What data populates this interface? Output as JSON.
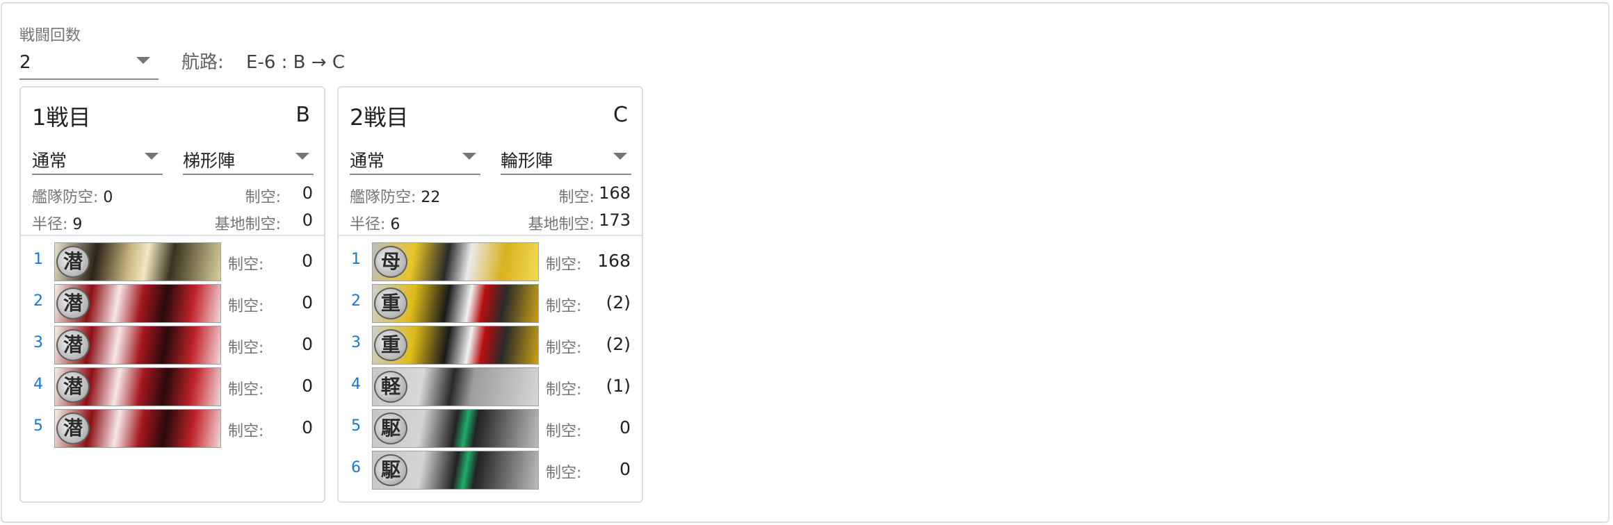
{
  "battle_count": {
    "label": "戦闘回数",
    "value": "2"
  },
  "route": {
    "label": "航路:",
    "value": "E-6 : B → C"
  },
  "cards": [
    {
      "title": "1戦目",
      "node": "B",
      "kind": "通常",
      "formation": "梯形陣",
      "fleet_aa_label": "艦隊防空:",
      "fleet_aa": "0",
      "radius_label": "半径:",
      "radius": "9",
      "air_label": "制空:",
      "air": "0",
      "base_air_label": "基地制空:",
      "base_air": "0",
      "ships": [
        {
          "index": "1",
          "type_glyph": "潜",
          "art": "art-sub",
          "air_label": "制空:",
          "air": "0"
        },
        {
          "index": "2",
          "type_glyph": "潜",
          "art": "art-red",
          "air_label": "制空:",
          "air": "0"
        },
        {
          "index": "3",
          "type_glyph": "潜",
          "art": "art-red",
          "air_label": "制空:",
          "air": "0"
        },
        {
          "index": "4",
          "type_glyph": "潜",
          "art": "art-red",
          "air_label": "制空:",
          "air": "0"
        },
        {
          "index": "5",
          "type_glyph": "潜",
          "art": "art-red",
          "air_label": "制空:",
          "air": "0"
        }
      ]
    },
    {
      "title": "2戦目",
      "node": "C",
      "kind": "通常",
      "formation": "輪形陣",
      "fleet_aa_label": "艦隊防空:",
      "fleet_aa": "22",
      "radius_label": "半径:",
      "radius": "6",
      "air_label": "制空:",
      "air": "168",
      "base_air_label": "基地制空:",
      "base_air": "173",
      "ships": [
        {
          "index": "1",
          "type_glyph": "母",
          "art": "art-carrier",
          "air_label": "制空:",
          "air": "168"
        },
        {
          "index": "2",
          "type_glyph": "重",
          "art": "art-heavy",
          "air_label": "制空:",
          "air": "(2)"
        },
        {
          "index": "3",
          "type_glyph": "重",
          "art": "art-heavy",
          "air_label": "制空:",
          "air": "(2)"
        },
        {
          "index": "4",
          "type_glyph": "軽",
          "art": "art-light",
          "air_label": "制空:",
          "air": "(1)"
        },
        {
          "index": "5",
          "type_glyph": "駆",
          "art": "art-dd",
          "air_label": "制空:",
          "air": "0"
        },
        {
          "index": "6",
          "type_glyph": "駆",
          "art": "art-dd",
          "air_label": "制空:",
          "air": "0"
        }
      ]
    }
  ]
}
